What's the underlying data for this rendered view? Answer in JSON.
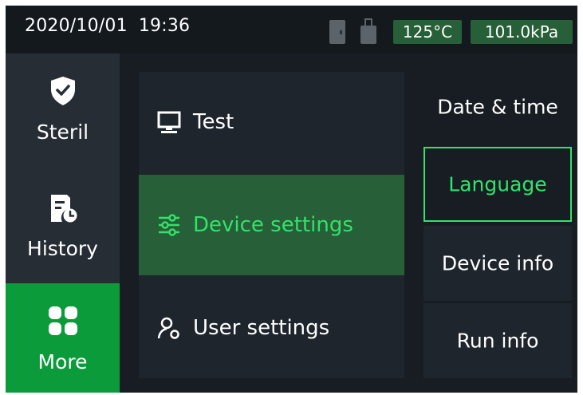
{
  "status": {
    "date": "2020/10/01",
    "time": "19:36",
    "temperature": "125°C",
    "pressure": "101.0kPa",
    "icons": [
      "door-icon",
      "usb-icon"
    ]
  },
  "nav": {
    "items": [
      {
        "label": "Steril",
        "icon": "shield-check-icon"
      },
      {
        "label": "History",
        "icon": "history-doc-icon"
      },
      {
        "label": "More",
        "icon": "grid-icon"
      }
    ],
    "active": "More"
  },
  "menu": {
    "items": [
      {
        "label": "Test",
        "icon": "monitor-icon"
      },
      {
        "label": "Device settings",
        "icon": "sliders-icon"
      },
      {
        "label": "User settings",
        "icon": "user-gear-icon"
      }
    ],
    "active": "Device settings"
  },
  "submenu": {
    "items": [
      {
        "label": "Date & time"
      },
      {
        "label": "Language"
      },
      {
        "label": "Device info"
      },
      {
        "label": "Run info"
      }
    ],
    "selected": "Language"
  },
  "colors": {
    "background": "#171d23",
    "nav_bg": "#262d35",
    "accent_green": "#0c9b3b",
    "highlight_green": "#30e36a",
    "badge_green": "#275f38"
  }
}
